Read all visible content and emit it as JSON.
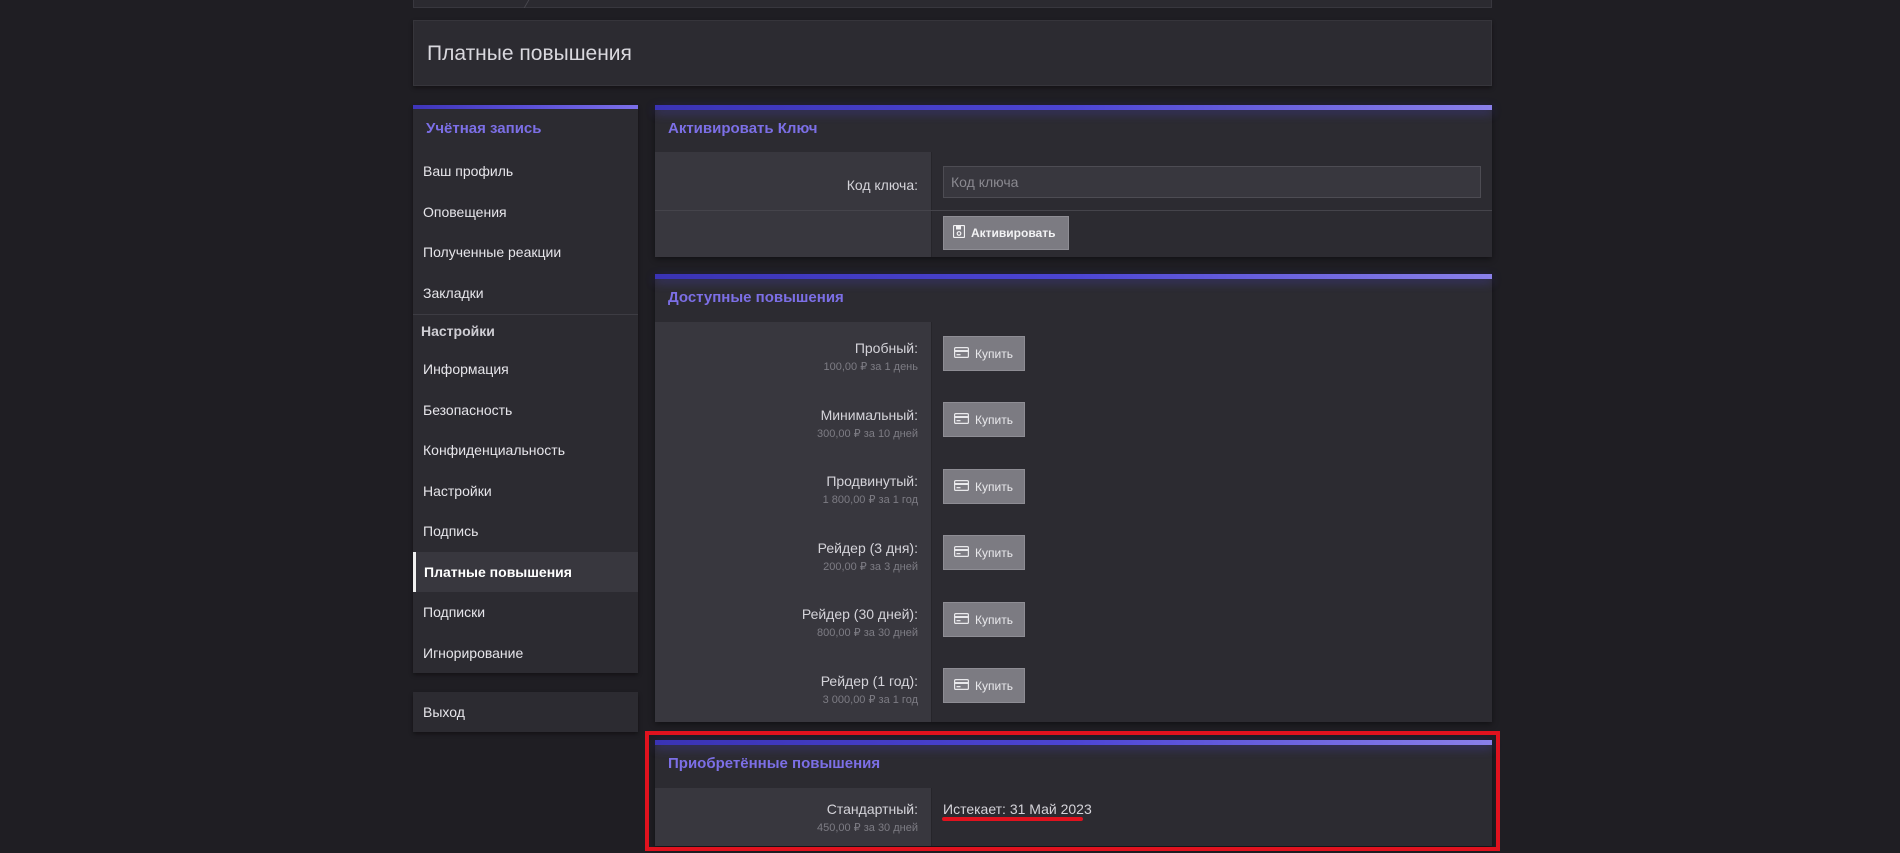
{
  "page": {
    "title": "Платные повышения"
  },
  "sidebar": {
    "account_header": "Учётная запись",
    "account_items": [
      {
        "label": "Ваш профиль"
      },
      {
        "label": "Оповещения"
      },
      {
        "label": "Полученные реакции"
      },
      {
        "label": "Закладки"
      }
    ],
    "settings_header": "Настройки",
    "settings_items": [
      {
        "label": "Информация"
      },
      {
        "label": "Безопасность"
      },
      {
        "label": "Конфиденциальность"
      },
      {
        "label": "Настройки"
      },
      {
        "label": "Подпись"
      },
      {
        "label": "Платные повышения",
        "active": true
      },
      {
        "label": "Подписки"
      },
      {
        "label": "Игнорирование"
      }
    ],
    "logout_label": "Выход"
  },
  "activate_key": {
    "header": "Активировать Ключ",
    "field_label": "Код ключа:",
    "placeholder": "Код ключа",
    "button_label": "Активировать"
  },
  "available_upgrades": {
    "header": "Доступные повышения",
    "buy_label": "Купить",
    "items": [
      {
        "name": "Пробный:",
        "price": "100,00 ₽ за 1 день"
      },
      {
        "name": "Минимальный:",
        "price": "300,00 ₽ за 10 дней"
      },
      {
        "name": "Продвинутый:",
        "price": "1 800,00 ₽ за 1 год"
      },
      {
        "name": "Рейдер (3 дня):",
        "price": "200,00 ₽ за 3 дней"
      },
      {
        "name": "Рейдер (30 дней):",
        "price": "800,00 ₽ за 30 дней"
      },
      {
        "name": "Рейдер (1 год):",
        "price": "3 000,00 ₽ за 1 год"
      }
    ]
  },
  "purchased_upgrades": {
    "header": "Приобретённые повышения",
    "items": [
      {
        "name": "Стандартный:",
        "price": "450,00 ₽ за 30 дней",
        "status": "Истекает: 31 Май 2023"
      }
    ]
  },
  "colors": {
    "accent": "#7c6fe6",
    "annotation": "#e0121e",
    "background": "#1f1e23"
  }
}
